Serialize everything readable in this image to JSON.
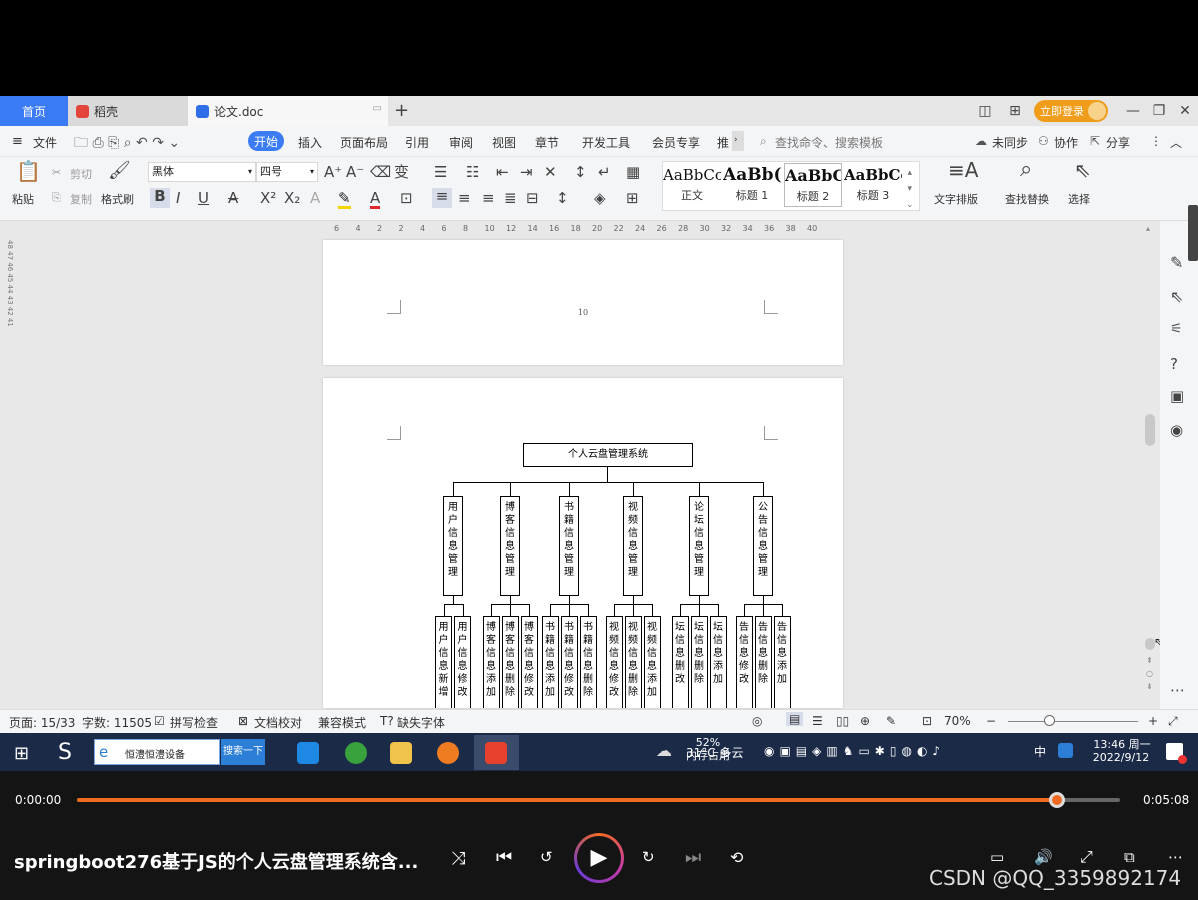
{
  "tabs": {
    "home": "首页",
    "daoke": "稻壳",
    "doc": "论文.doc",
    "new_tab": "+"
  },
  "login_label": "立即登录",
  "menu": {
    "file": "文件",
    "items": [
      "开始",
      "插入",
      "页面布局",
      "引用",
      "审阅",
      "视图",
      "章节",
      "开发工具",
      "会员专享",
      "推"
    ],
    "search_placeholder": "查找命令、搜索模板",
    "sync": "未同步",
    "collab": "协作",
    "share": "分享"
  },
  "ribbon": {
    "paste": "粘贴",
    "cut": "剪切",
    "copy": "复制",
    "format_painter": "格式刷",
    "font_name": "黑体",
    "font_size": "四号",
    "styles": [
      {
        "preview": "AaBbCcI",
        "name": "正文"
      },
      {
        "preview": "AaBb(",
        "name": "标题 1"
      },
      {
        "preview": "AaBbC",
        "name": "标题 2"
      },
      {
        "preview": "AaBbCcl",
        "name": "标题 3"
      }
    ],
    "text_layout": "文字排版",
    "find_replace": "查找替换",
    "select": "选择"
  },
  "ruler_ticks": [
    "6",
    "4",
    "2",
    "2",
    "4",
    "6",
    "8",
    "10",
    "12",
    "14",
    "16",
    "18",
    "20",
    "22",
    "24",
    "26",
    "28",
    "30",
    "32",
    "34",
    "36",
    "38",
    "40"
  ],
  "vruler_text": "48 47 46 45 44 43 42 41",
  "document": {
    "page_number": "10",
    "diagram": {
      "root": "个人云盘管理系统",
      "modules": [
        {
          "name": "用户信息管理",
          "children": [
            "用户信息新增",
            "用户信息修改"
          ]
        },
        {
          "name": "博客信息管理",
          "children": [
            "博客信息添加",
            "博客信息删除",
            "博客信息修改"
          ]
        },
        {
          "name": "书籍信息管理",
          "children": [
            "书籍信息添加",
            "书籍信息修改",
            "书籍信息删除"
          ]
        },
        {
          "name": "视频信息管理",
          "children": [
            "视频信息修改",
            "视频信息删除",
            "视频信息添加"
          ]
        },
        {
          "name": "论坛信息管理",
          "children": [
            "坛信息删改",
            "坛信息删除",
            "坛信息添加"
          ]
        },
        {
          "name": "公告信息管理",
          "children": [
            "告信息修改",
            "告信息删除",
            "告信息添加"
          ]
        }
      ]
    }
  },
  "status": {
    "page": "页面: 15/33",
    "words": "字数: 11505",
    "spell": "拼写检查",
    "proof": "文档校对",
    "compat": "兼容模式",
    "missing_font": "缺失字体",
    "zoom": "70%"
  },
  "taskbar": {
    "search_text": "恒澧恒澧设备",
    "search_button": "搜索一下",
    "weather": "31°C 多云",
    "memory": "52%\n内存占用",
    "ime": "中",
    "time": "13:46 周一",
    "date": "2022/9/12"
  },
  "player": {
    "time_current": "0:00:00",
    "time_total": "0:05:08",
    "progress": 0.94,
    "title": "springboot276基于JS的个人云盘管理系统含...",
    "watermark": "CSDN @QQ_3359892174"
  }
}
